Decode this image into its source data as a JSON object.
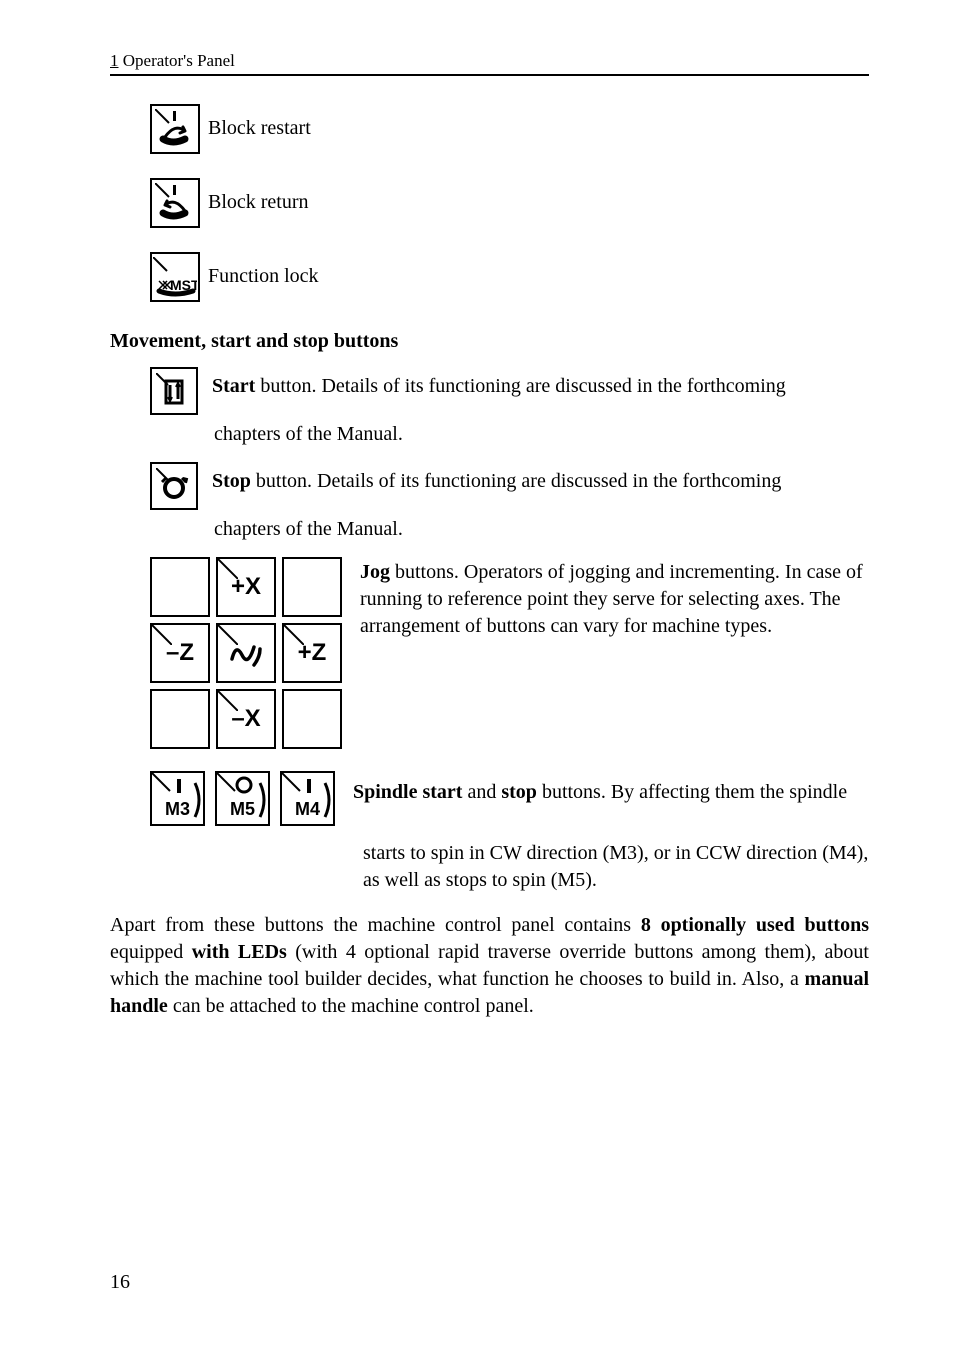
{
  "header": {
    "link": "1",
    "rest": " Operator's Panel"
  },
  "icons": {
    "block_restart": "Block restart",
    "block_return": "Block return",
    "function_lock": "Function lock"
  },
  "section_head": "Movement, start and stop buttons",
  "start": {
    "bold": "Start",
    "line1_rest": " button. Details of its functioning are discussed in the forthcoming",
    "line2": "chapters of the Manual."
  },
  "stop": {
    "bold": " Stop",
    "line1_rest": " button. Details of its functioning are discussed in the forthcoming",
    "line2": "chapters of the Manual."
  },
  "jog": {
    "plus_x": "+X",
    "minus_z": "–Z",
    "plus_z": "+Z",
    "minus_x": "–X",
    "text_bold": "Jog",
    "text_rest1": " buttons. Operators of jogging and incrementing. In case of running to reference point they serve for selecting axes. The arrangement of buttons can vary for machine types."
  },
  "spindle": {
    "m3": "M3",
    "m5": "M5",
    "m4": "M4",
    "bold1": "Spindle start",
    "mid": " and ",
    "bold2": "stop",
    "rest1": " buttons. By affecting them the spindle",
    "line2": "starts to spin in CW direction (M3), or in CCW direction (M4), as well as stops to spin (M5)."
  },
  "para": {
    "t1": "Apart from these buttons the machine control panel contains ",
    "b1": "8 optionally used buttons",
    "t2": " equipped ",
    "b2": "with LEDs",
    "t3": " (with 4 optional rapid traverse override buttons among them), about which the machine tool builder decides, what function he chooses to build in. Also, a ",
    "b3": "manual handle",
    "t4": " can be attached to the machine control panel."
  },
  "page_number": "16"
}
